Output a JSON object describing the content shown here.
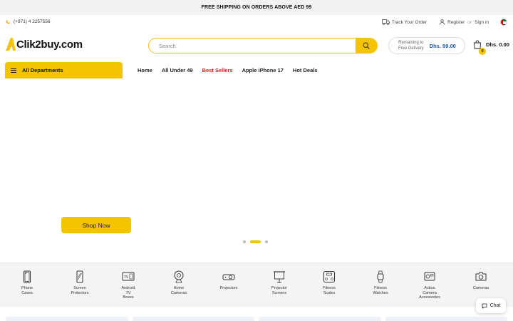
{
  "topbar": {
    "text": "FREE SHIPPING ON ORDERS ABOVE AED 99"
  },
  "info": {
    "phone": "(+971) 4 2257556",
    "track": "Track Your Order",
    "register": "Register",
    "or": "or",
    "signin": "Sign in"
  },
  "header": {
    "logo": "Clik2buy.com",
    "search_placeholder": "Search",
    "delivery_label_1": "Remaining to",
    "delivery_label_2": "Free Delivery",
    "delivery_amount": "Dhs. 99.00",
    "cart_count": "0",
    "cart_total": "Dhs. 0.00"
  },
  "nav": {
    "departments": "All Departments",
    "links": [
      "Home",
      "All Under 49",
      "Best Sellers",
      "Apple iPhone 17",
      "Hot Deals"
    ]
  },
  "hero": {
    "cta": "Shop Now",
    "slides": 3,
    "active_slide": 2
  },
  "categories": [
    {
      "l1": "Phone",
      "l2": "Cases",
      "l3": "",
      "icon": "phone-case-icon"
    },
    {
      "l1": "Screen",
      "l2": "Protectors",
      "l3": "",
      "icon": "screen-protector-icon"
    },
    {
      "l1": "Android",
      "l2": "TV",
      "l3": "Boxes",
      "icon": "tv-box-icon"
    },
    {
      "l1": "Home",
      "l2": "Cameras",
      "l3": "",
      "icon": "home-camera-icon"
    },
    {
      "l1": "Projectors",
      "l2": "",
      "l3": "",
      "icon": "projector-icon"
    },
    {
      "l1": "Projector",
      "l2": "Screens",
      "l3": "",
      "icon": "projector-screen-icon"
    },
    {
      "l1": "Fitness",
      "l2": "Scales",
      "l3": "",
      "icon": "scale-icon"
    },
    {
      "l1": "Fitness",
      "l2": "Watches",
      "l3": "",
      "icon": "watch-icon"
    },
    {
      "l1": "Action",
      "l2": "Camera",
      "l3": "Accessories",
      "icon": "action-camera-icon"
    },
    {
      "l1": "Cameras",
      "l2": "",
      "l3": "",
      "icon": "camera-icon"
    }
  ],
  "chat": {
    "label": "Chat"
  },
  "colors": {
    "accent": "#f5c400",
    "link_red": "#d0211b",
    "price_blue": "#1c5aa6"
  }
}
